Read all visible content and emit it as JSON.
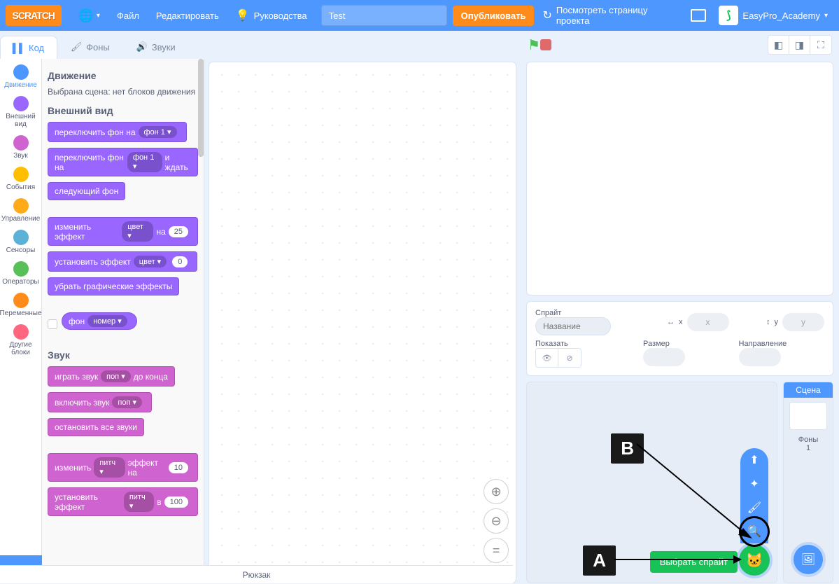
{
  "menu": {
    "logo": "SCRATCH",
    "file": "Файл",
    "edit": "Редактировать",
    "tutorials": "Руководства",
    "publish": "Опубликовать",
    "see_page": "Посмотреть страницу проекта",
    "project_name": "Test",
    "username": "EasyPro_Academy"
  },
  "tabs": {
    "code": "Код",
    "costumes": "Фоны",
    "sounds": "Звуки"
  },
  "categories": [
    {
      "label": "Движение",
      "color": "#4c97ff"
    },
    {
      "label": "Внешний вид",
      "color": "#9966ff"
    },
    {
      "label": "Звук",
      "color": "#cf63cf"
    },
    {
      "label": "События",
      "color": "#ffbf00"
    },
    {
      "label": "Управление",
      "color": "#ffab19"
    },
    {
      "label": "Сенсоры",
      "color": "#5cb1d6"
    },
    {
      "label": "Операторы",
      "color": "#59c059"
    },
    {
      "label": "Переменные",
      "color": "#ff8c1a"
    },
    {
      "label": "Другие блоки",
      "color": "#ff6680"
    }
  ],
  "palette": {
    "motion_heading": "Движение",
    "motion_note": "Выбрана сцена: нет блоков движения",
    "looks_heading": "Внешний вид",
    "switch_bd_to": "переключить фон на",
    "bd1": "фон 1",
    "switch_bd_wait": "и ждать",
    "next_bd": "следующий фон",
    "change_effect": "изменить эффект",
    "color": "цвет",
    "by": "на",
    "val25": "25",
    "set_effect": "установить эффект",
    "val0": "0",
    "clear_effects": "убрать графические эффекты",
    "bd_reporter": "фон",
    "number": "номер",
    "sound_heading": "Звук",
    "play_until": "играть звук",
    "pop": "поп",
    "until_done": "до конца",
    "start_sound": "включить звук",
    "stop_sounds": "остановить все звуки",
    "change_pitch": "изменить",
    "pitch": "питч",
    "effect_by": "эффект на",
    "val10": "10",
    "set_pitch": "установить эффект",
    "to": "в",
    "val100": "100"
  },
  "sprite_info": {
    "sprite_label": "Спрайт",
    "name_placeholder": "Название",
    "x_label": "x",
    "x_val": "x",
    "y_label": "y",
    "y_val": "y",
    "show_label": "Показать",
    "size_label": "Размер",
    "direction_label": "Направление"
  },
  "stage_panel": {
    "title": "Сцена",
    "backdrops": "Фоны",
    "count": "1"
  },
  "tooltip_choose_sprite": "Выбрать спрайт",
  "backpack": "Рюкзак",
  "annotations": {
    "a": "A",
    "b": "B"
  }
}
